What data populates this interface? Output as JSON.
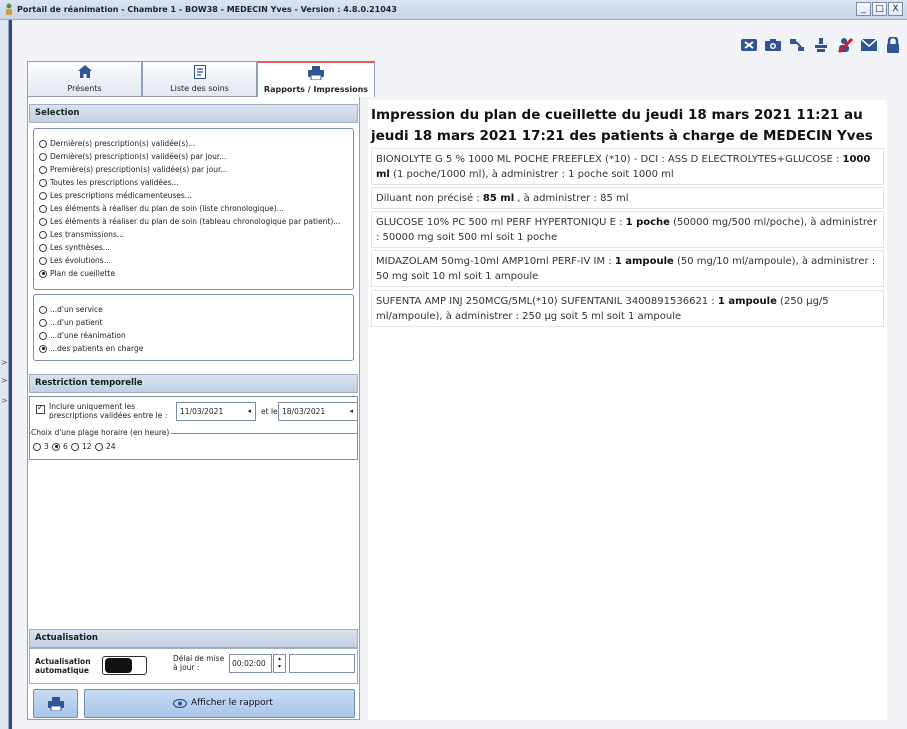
{
  "window": {
    "title": "Portail de réanimation - Chambre 1 - BOW38 - MEDECIN Yves - Version : 4.8.0.21043",
    "controls": [
      "_",
      "□",
      "X"
    ]
  },
  "toolbar": {
    "icons": [
      "export-icon",
      "camera-icon",
      "connect-icon",
      "disconnect-icon",
      "user-cross-icon",
      "mail-icon",
      "lock-icon"
    ]
  },
  "tabs": [
    {
      "label": "Présents",
      "icon": "home-icon"
    },
    {
      "label": "Liste des soins",
      "icon": "checklist-icon"
    },
    {
      "label": "Rapports / Impressions",
      "icon": "printer-icon",
      "active": true
    }
  ],
  "selection": {
    "header": "Selection",
    "options": [
      {
        "label": "Dernière(s) prescription(s) validée(s)...",
        "selected": false
      },
      {
        "label": "Dernière(s) prescription(s) validée(s) par jour...",
        "selected": false
      },
      {
        "label": "Première(s) prescription(s) validée(s) par jour...",
        "selected": false
      },
      {
        "label": "Toutes les prescriptions validées...",
        "selected": false
      },
      {
        "label": "Les prescriptions médicamenteuses...",
        "selected": false
      },
      {
        "label": "Les éléments à réaliser du plan de soin (liste chronologique)...",
        "selected": false
      },
      {
        "label": "Les éléments à réaliser du plan de soin (tableau chronologique par patient)...",
        "selected": false
      },
      {
        "label": "Les transmissions...",
        "selected": false
      },
      {
        "label": "Les synthèses...",
        "selected": false
      },
      {
        "label": "Les évolutions...",
        "selected": false
      },
      {
        "label": "Plan de cueillette",
        "selected": true
      }
    ],
    "scope_options": [
      {
        "label": "...d'un service",
        "selected": false
      },
      {
        "label": "...d'un patient",
        "selected": false
      },
      {
        "label": "...d'une réanimation",
        "selected": false
      },
      {
        "label": "...des patients en charge",
        "selected": true
      }
    ]
  },
  "restriction": {
    "header": "Restriction temporelle",
    "include_label": "Inclure uniquement les prescriptions validées entre le :",
    "include_checked": true,
    "date_from": "11/03/2021",
    "between_label": "et le",
    "date_to": "18/03/2021",
    "hours_legend": "Choix d'une plage horaire (en heure)",
    "hours": [
      {
        "label": "3",
        "selected": false
      },
      {
        "label": "6",
        "selected": true
      },
      {
        "label": "12",
        "selected": false
      },
      {
        "label": "24",
        "selected": false
      }
    ]
  },
  "actualisation": {
    "header": "Actualisation",
    "auto_label": "Actualisation automatique",
    "auto_on": true,
    "delay_label": "Délai de mise à jour :",
    "delay_value": "00:02:00",
    "extra_value": ""
  },
  "actions": {
    "show_report": "Afficher le rapport"
  },
  "report": {
    "title": "Impression du plan de cueillette du jeudi 18 mars 2021 11:21 au jeudi 18 mars 2021 17:21 des patients à charge de MEDECIN Yves",
    "items": [
      {
        "pre": "BIONOLYTE G 5 % 1000 ML POCHE FREEFLEX (*10) - DCI : ASS D ELECTROLYTES+GLUCOSE : ",
        "qty": "1000 ml",
        "post": " (1 poche/1000 ml), à administrer : 1 poche soit 1000 ml"
      },
      {
        "pre": "Diluant non précisé : ",
        "qty": "85 ml",
        "post": " , à administrer : 85 ml"
      },
      {
        "pre": "GLUCOSE 10% PC 500 ml PERF HYPERTONIQU E : ",
        "qty": "1 poche",
        "post": " (50000 mg/500 ml/poche), à administrer : 50000 mg soit 500 ml soit 1 poche"
      },
      {
        "pre": "MIDAZOLAM 50mg-10ml AMP10ml PERF-IV IM : ",
        "qty": "1 ampoule",
        "post": " (50 mg/10 ml/ampoule), à administrer : 50 mg soit 10 ml soit 1 ampoule"
      },
      {
        "pre": "SUFENTA AMP INJ 250MCG/5ML(*10) SUFENTANIL 3400891536621 : ",
        "qty": "1 ampoule",
        "post": " (250 µg/5 ml/ampoule), à administrer : 250 µg soit 5 ml soit 1 ampoule"
      }
    ]
  },
  "left_strip_arrows": [
    ">",
    ">",
    ">"
  ]
}
